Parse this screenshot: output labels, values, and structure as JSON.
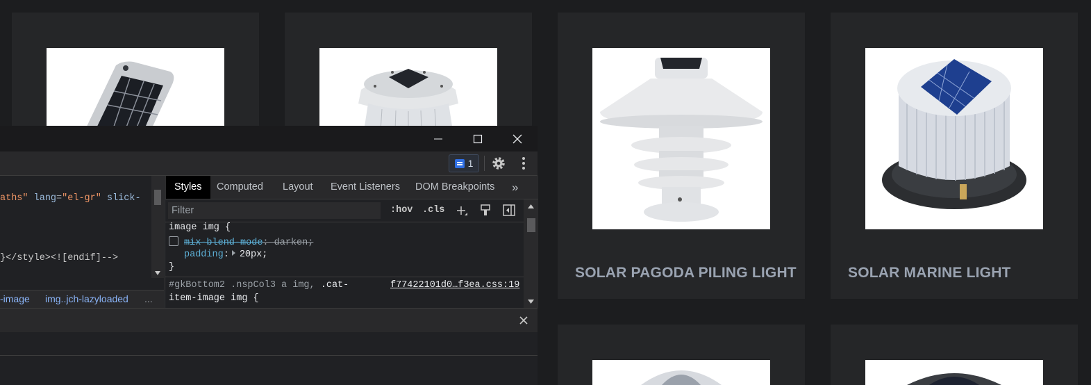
{
  "products": [
    {
      "title": "",
      "image": "solar-panel-light-tilted"
    },
    {
      "title": "",
      "image": "solar-beacon-top"
    },
    {
      "title": "SOLAR PAGODA PILING LIGHT",
      "image": "pagoda-light"
    },
    {
      "title": "SOLAR MARINE LIGHT",
      "image": "marine-light"
    },
    {
      "title": "",
      "image": "solar-light-dome"
    },
    {
      "title": "",
      "image": "solar-light-disc"
    }
  ],
  "devtools": {
    "issues_count": "1",
    "elements_lines": [
      {
        "attr_tail": "aths\"",
        "attr_name": "lang",
        "attr_value": "\"el-gr\"",
        "rest": "slick-"
      },
      {
        "text": "}</style><![endif]-->"
      }
    ],
    "breadcrumbs": [
      "-image",
      "img..jch-lazyloaded",
      "..."
    ],
    "tabs": [
      "Styles",
      "Computed",
      "Layout",
      "Event Listeners",
      "DOM Breakpoints",
      "»"
    ],
    "filter_placeholder": "Filter",
    "hov_label": ":hov",
    "cls_label": ".cls",
    "rules": {
      "rule1_selector": "image img {",
      "rule1_prop1_name": "mix-blend-mode",
      "rule1_prop1_value": ": darken;",
      "rule1_prop2_name": "padding",
      "rule1_prop2_value": "20px;",
      "rule1_close": "}",
      "rule2_selector_dim": "#gkBottom2 .nspCol3 a img,",
      "rule2_selector_a": ".cat-",
      "rule2_selector_b": "item-image img {",
      "rule2_source": "f77422101d0…f3ea.css:19"
    },
    "colors": {
      "accent_blue": "#8ab4f8",
      "badge": "#2f6fe4"
    }
  }
}
